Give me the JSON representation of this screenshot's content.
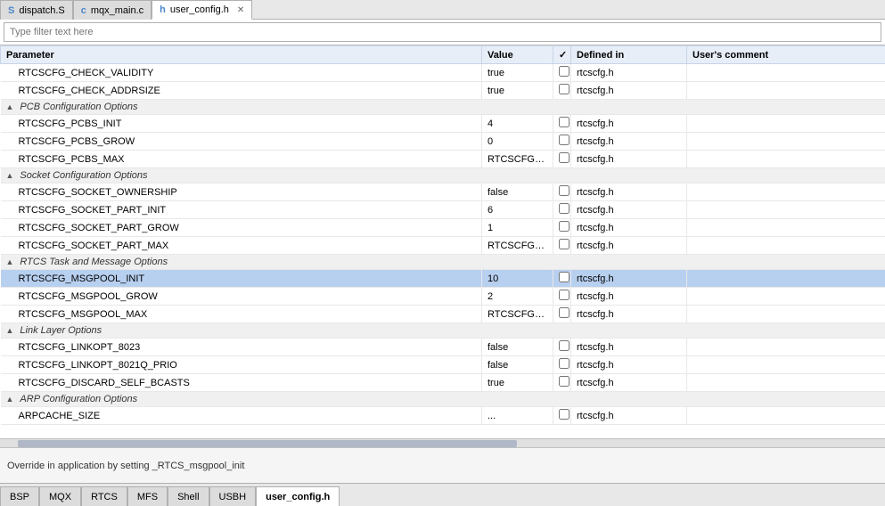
{
  "top_tabs": [
    {
      "id": "dispatch",
      "label": "dispatch.S",
      "icon": "S",
      "active": false,
      "closeable": false
    },
    {
      "id": "mqx_main",
      "label": "mqx_main.c",
      "icon": "c",
      "active": false,
      "closeable": false
    },
    {
      "id": "user_config",
      "label": "user_config.h",
      "icon": "h",
      "active": true,
      "closeable": true
    }
  ],
  "filter": {
    "placeholder": "Type filter text here"
  },
  "columns": {
    "parameter": "Parameter",
    "value": "Value",
    "check": "✓",
    "defined_in": "Defined in",
    "user_comment": "User's comment"
  },
  "rows": [
    {
      "type": "data",
      "indent": true,
      "param": "RTCSCFG_CHECK_VALIDITY",
      "value": "true",
      "checked": false,
      "defined": "rtcscfg.h",
      "comment": ""
    },
    {
      "type": "data",
      "indent": true,
      "param": "RTCSCFG_CHECK_ADDRSIZE",
      "value": "true",
      "checked": false,
      "defined": "rtcscfg.h",
      "comment": ""
    },
    {
      "type": "group",
      "label": "PCB Configuration Options"
    },
    {
      "type": "data",
      "indent": true,
      "param": "RTCSCFG_PCBS_INIT",
      "value": "4",
      "checked": false,
      "defined": "rtcscfg.h",
      "comment": ""
    },
    {
      "type": "data",
      "indent": true,
      "param": "RTCSCFG_PCBS_GROW",
      "value": "0",
      "checked": false,
      "defined": "rtcscfg.h",
      "comment": ""
    },
    {
      "type": "data",
      "indent": true,
      "param": "RTCSCFG_PCBS_MAX",
      "value": "RTCSCFG_PCBS_...",
      "checked": false,
      "defined": "rtcscfg.h",
      "comment": ""
    },
    {
      "type": "group",
      "label": "Socket Configuration Options"
    },
    {
      "type": "data",
      "indent": true,
      "param": "RTCSCFG_SOCKET_OWNERSHIP",
      "value": "false",
      "checked": false,
      "defined": "rtcscfg.h",
      "comment": ""
    },
    {
      "type": "data",
      "indent": true,
      "param": "RTCSCFG_SOCKET_PART_INIT",
      "value": "6",
      "checked": false,
      "defined": "rtcscfg.h",
      "comment": ""
    },
    {
      "type": "data",
      "indent": true,
      "param": "RTCSCFG_SOCKET_PART_GROW",
      "value": "1",
      "checked": false,
      "defined": "rtcscfg.h",
      "comment": ""
    },
    {
      "type": "data",
      "indent": true,
      "param": "RTCSCFG_SOCKET_PART_MAX",
      "value": "RTCSCFG_SOCK...",
      "checked": false,
      "defined": "rtcscfg.h",
      "comment": ""
    },
    {
      "type": "group",
      "label": "RTCS Task and Message Options"
    },
    {
      "type": "data",
      "indent": true,
      "param": "RTCSCFG_MSGPOOL_INIT",
      "value": "10",
      "checked": false,
      "defined": "rtcscfg.h",
      "comment": "",
      "selected": true
    },
    {
      "type": "data",
      "indent": true,
      "param": "RTCSCFG_MSGPOOL_GROW",
      "value": "2",
      "checked": false,
      "defined": "rtcscfg.h",
      "comment": ""
    },
    {
      "type": "data",
      "indent": true,
      "param": "RTCSCFG_MSGPOOL_MAX",
      "value": "RTCSCFG_MSGP...",
      "checked": false,
      "defined": "rtcscfg.h",
      "comment": ""
    },
    {
      "type": "group",
      "label": "Link Layer Options"
    },
    {
      "type": "data",
      "indent": true,
      "param": "RTCSCFG_LINKOPT_8023",
      "value": "false",
      "checked": false,
      "defined": "rtcscfg.h",
      "comment": ""
    },
    {
      "type": "data",
      "indent": true,
      "param": "RTCSCFG_LINKOPT_8021Q_PRIO",
      "value": "false",
      "checked": false,
      "defined": "rtcscfg.h",
      "comment": ""
    },
    {
      "type": "data",
      "indent": true,
      "param": "RTCSCFG_DISCARD_SELF_BCASTS",
      "value": "true",
      "checked": false,
      "defined": "rtcscfg.h",
      "comment": ""
    },
    {
      "type": "group",
      "label": "ARP Configuration Options"
    },
    {
      "type": "data",
      "indent": true,
      "param": "ARPCACHE_SIZE",
      "value": "...",
      "checked": false,
      "defined": "rtcscfg.h",
      "comment": ""
    }
  ],
  "status_bar": {
    "text": "Override in application by setting _RTCS_msgpool_init"
  },
  "bottom_tabs": [
    {
      "id": "bsp",
      "label": "BSP",
      "active": false
    },
    {
      "id": "mqx",
      "label": "MQX",
      "active": false
    },
    {
      "id": "rtcs",
      "label": "RTCS",
      "active": false
    },
    {
      "id": "mfs",
      "label": "MFS",
      "active": false
    },
    {
      "id": "shell",
      "label": "Shell",
      "active": false
    },
    {
      "id": "usbh",
      "label": "USBH",
      "active": false
    },
    {
      "id": "user_config_tab",
      "label": "user_config.h",
      "active": true
    }
  ]
}
